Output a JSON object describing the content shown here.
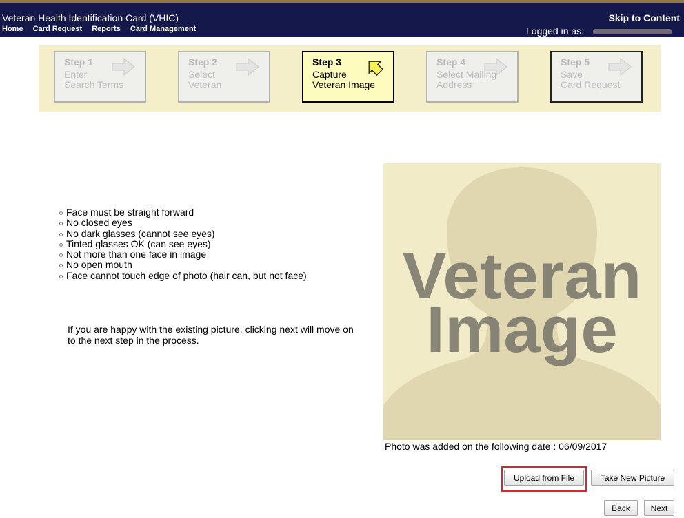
{
  "header": {
    "app_title": "Veteran Health Identification Card (VHIC)",
    "skip_link": "Skip to Content",
    "nav": [
      "Home",
      "Card Request",
      "Reports",
      "Card Management"
    ],
    "logged_in_label": "Logged in as:"
  },
  "steps": [
    {
      "title": "Step 1",
      "line1": "Enter",
      "line2": "Search Terms",
      "active": false,
      "icon": "arrow-right-icon"
    },
    {
      "title": "Step 2",
      "line1": "Select",
      "line2": "Veteran",
      "active": false,
      "icon": "arrow-right-icon"
    },
    {
      "title": "Step 3",
      "line1": "Capture",
      "line2": "Veteran Image",
      "active": true,
      "icon": "arrow-down-icon"
    },
    {
      "title": "Step 4",
      "line1": "Select Mailing",
      "line2": "Address",
      "active": false,
      "icon": "arrow-right-icon"
    },
    {
      "title": "Step 5",
      "line1": "Save",
      "line2": "Card Request",
      "active": false,
      "icon": "arrow-right-icon"
    }
  ],
  "requirements": [
    "Face must be straight forward",
    "No closed eyes",
    "No dark glasses (cannot see eyes)",
    "Tinted glasses OK (can see eyes)",
    "Not more than one face in image",
    "No open mouth",
    "Face cannot touch edge of photo (hair can, but not face)"
  ],
  "instructions": "If you are happy with the existing picture, clicking next will move on to the next step in the process.",
  "photo": {
    "placeholder_line1": "Veteran",
    "placeholder_line2": "Image",
    "caption": "Photo was added on the following date : 06/09/2017"
  },
  "buttons": {
    "upload": "Upload from File",
    "take_picture": "Take New Picture",
    "back": "Back",
    "next": "Next"
  },
  "colors": {
    "header_bg": "#14184a",
    "step_bar_bg": "#f5efc9",
    "active_step_bg": "#fdfcbe",
    "highlight": "#d8262e"
  }
}
